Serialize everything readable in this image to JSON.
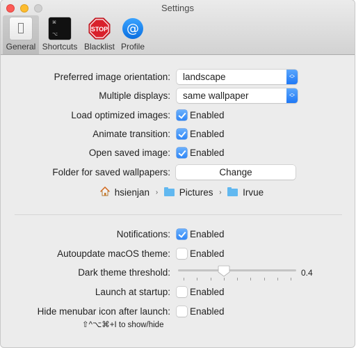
{
  "window": {
    "title": "Settings",
    "traffic_lights": [
      "close",
      "minimize",
      "zoom"
    ]
  },
  "toolbar": {
    "tabs": [
      {
        "label": "General",
        "icon": "switch-icon",
        "active": true
      },
      {
        "label": "Shortcuts",
        "icon": "keyboard-key-icon",
        "active": false
      },
      {
        "label": "Blacklist",
        "icon": "stop-sign-icon",
        "active": false
      },
      {
        "label": "Profile",
        "icon": "at-sign-icon",
        "active": false
      }
    ],
    "shortcuts_icon_keys": [
      "⌘",
      "⌥"
    ],
    "stop_text": "STOP",
    "at_text": "@"
  },
  "general": {
    "orientation": {
      "label": "Preferred image orientation:",
      "value": "landscape"
    },
    "displays": {
      "label": "Multiple displays:",
      "value": "same wallpaper"
    },
    "load_optimized": {
      "label": "Load optimized images:",
      "checkbox_label": "Enabled",
      "checked": true
    },
    "animate": {
      "label": "Animate transition:",
      "checkbox_label": "Enabled",
      "checked": true
    },
    "open_saved": {
      "label": "Open saved image:",
      "checkbox_label": "Enabled",
      "checked": true
    },
    "folder": {
      "label": "Folder for saved wallpapers:",
      "button_label": "Change"
    },
    "path": {
      "segments": [
        {
          "name": "hsienjan",
          "icon": "home-icon"
        },
        {
          "name": "Pictures",
          "icon": "pictures-folder-icon"
        },
        {
          "name": "Irvue",
          "icon": "folder-icon"
        }
      ],
      "separator": "›"
    },
    "notifications": {
      "label": "Notifications:",
      "checkbox_label": "Enabled",
      "checked": true
    },
    "autoupdate": {
      "label": "Autoupdate macOS theme:",
      "checkbox_label": "Enabled",
      "checked": false
    },
    "dark_threshold": {
      "label": "Dark theme threshold:",
      "value": 0.4,
      "value_text": "0.4",
      "min": 0,
      "max": 1,
      "ticks": 9
    },
    "launch": {
      "label": "Launch at startup:",
      "checkbox_label": "Enabled",
      "checked": false
    },
    "hide_menubar": {
      "label": "Hide menubar icon after launch:",
      "checkbox_label": "Enabled",
      "checked": false
    },
    "hint": "⇧^⌥⌘+I to show/hide"
  },
  "colors": {
    "accent": "#2f86f6",
    "window_bg": "#ececec"
  }
}
